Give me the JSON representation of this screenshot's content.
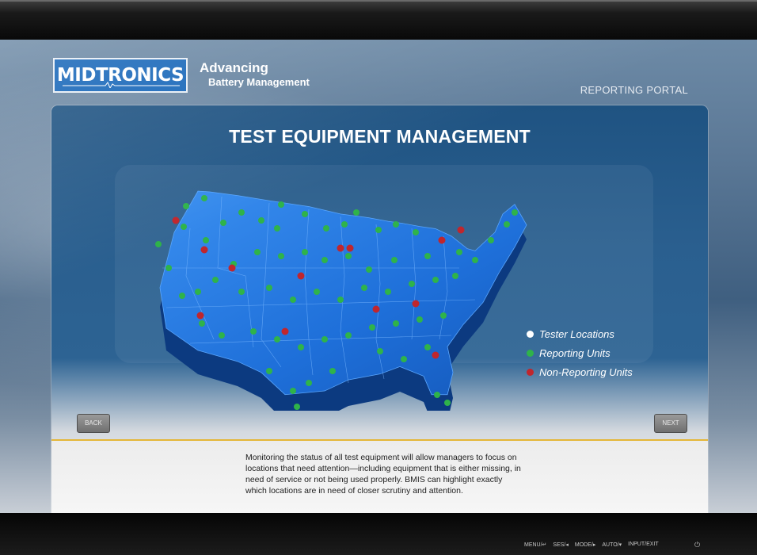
{
  "brand": {
    "logo_text": "MIDTRONICS",
    "tagline_line1": "Advancing",
    "tagline_line2": "Battery Management"
  },
  "portal_label": "REPORTING PORTAL",
  "page_title": "TEST EQUIPMENT MANAGEMENT",
  "legend": {
    "items": [
      {
        "label": "Tester Locations",
        "color": "#ffffff"
      },
      {
        "label": "Reporting Units",
        "color": "#2fb34a"
      },
      {
        "label": "Non-Reporting Units",
        "color": "#c0262d"
      }
    ]
  },
  "nav": {
    "back_label": "BACK",
    "next_label": "NEXT"
  },
  "description": "Monitoring the status of all test equipment will allow managers to focus on locations that need attention—including equipment that is either missing, in need of service or not being used properly. BMIS can highlight exactly which locations are in need of closer scrutiny and attention.",
  "monitor_controls": {
    "buttons": [
      "MENU/↵",
      "SES/◂",
      "MODE/▸",
      "AUTO/▾",
      "INPUT/EXIT"
    ],
    "power_symbol": "⏻"
  },
  "colors": {
    "map_fill": "#1e6fd9",
    "map_side": "#0d3f86",
    "reporting": "#2fb34a",
    "non_reporting": "#c0262d",
    "accent_line": "#e4b638"
  }
}
